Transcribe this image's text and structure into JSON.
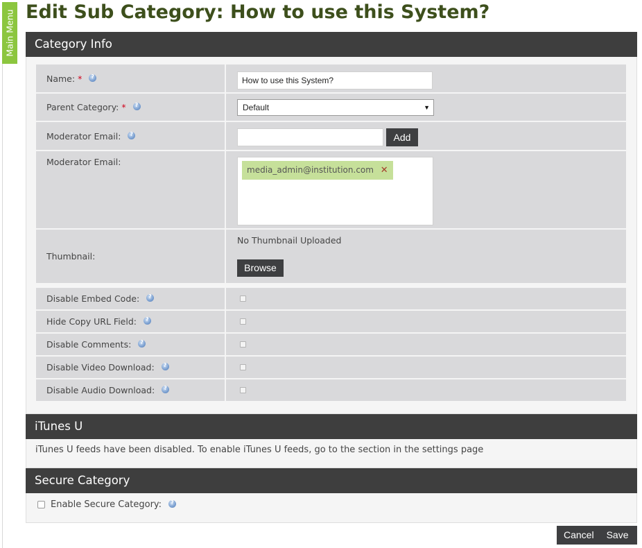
{
  "sidebar": {
    "main_menu_label": "Main Menu"
  },
  "page": {
    "title": "Edit Sub Category: How to use this System?"
  },
  "category_info": {
    "header": "Category Info",
    "name": {
      "label": "Name:",
      "required": "*",
      "value": "How to use this System?"
    },
    "parent_category": {
      "label": "Parent Category:",
      "required": "*",
      "selected": "Default"
    },
    "moderator_email_input": {
      "label": "Moderator Email:",
      "value": "",
      "add_label": "Add"
    },
    "moderator_email_list": {
      "label": "Moderator Email:",
      "emails": [
        "media_admin@institution.com"
      ],
      "remove_glyph": "✕"
    },
    "thumbnail": {
      "label": "Thumbnail:",
      "status": "No Thumbnail Uploaded",
      "browse_label": "Browse"
    },
    "toggles": [
      {
        "label": "Disable Embed Code:",
        "checked": false
      },
      {
        "label": "Hide Copy URL Field:",
        "checked": false
      },
      {
        "label": "Disable Comments:",
        "checked": false
      },
      {
        "label": "Disable Video Download:",
        "checked": false
      },
      {
        "label": "Disable Audio Download:",
        "checked": false
      }
    ]
  },
  "itunes": {
    "header": "iTunes U",
    "message": "iTunes U feeds have been disabled. To enable iTunes U feeds, go to the section in the settings page"
  },
  "secure_category": {
    "header": "Secure Category",
    "enable_label": "Enable Secure Category:",
    "checked": false
  },
  "footer": {
    "cancel_label": "Cancel",
    "save_label": "Save"
  },
  "colors": {
    "accent": "#8cc63f",
    "header_bg": "#3e3e3e",
    "title": "#3d4f1c",
    "tag": "#c6e09a"
  }
}
